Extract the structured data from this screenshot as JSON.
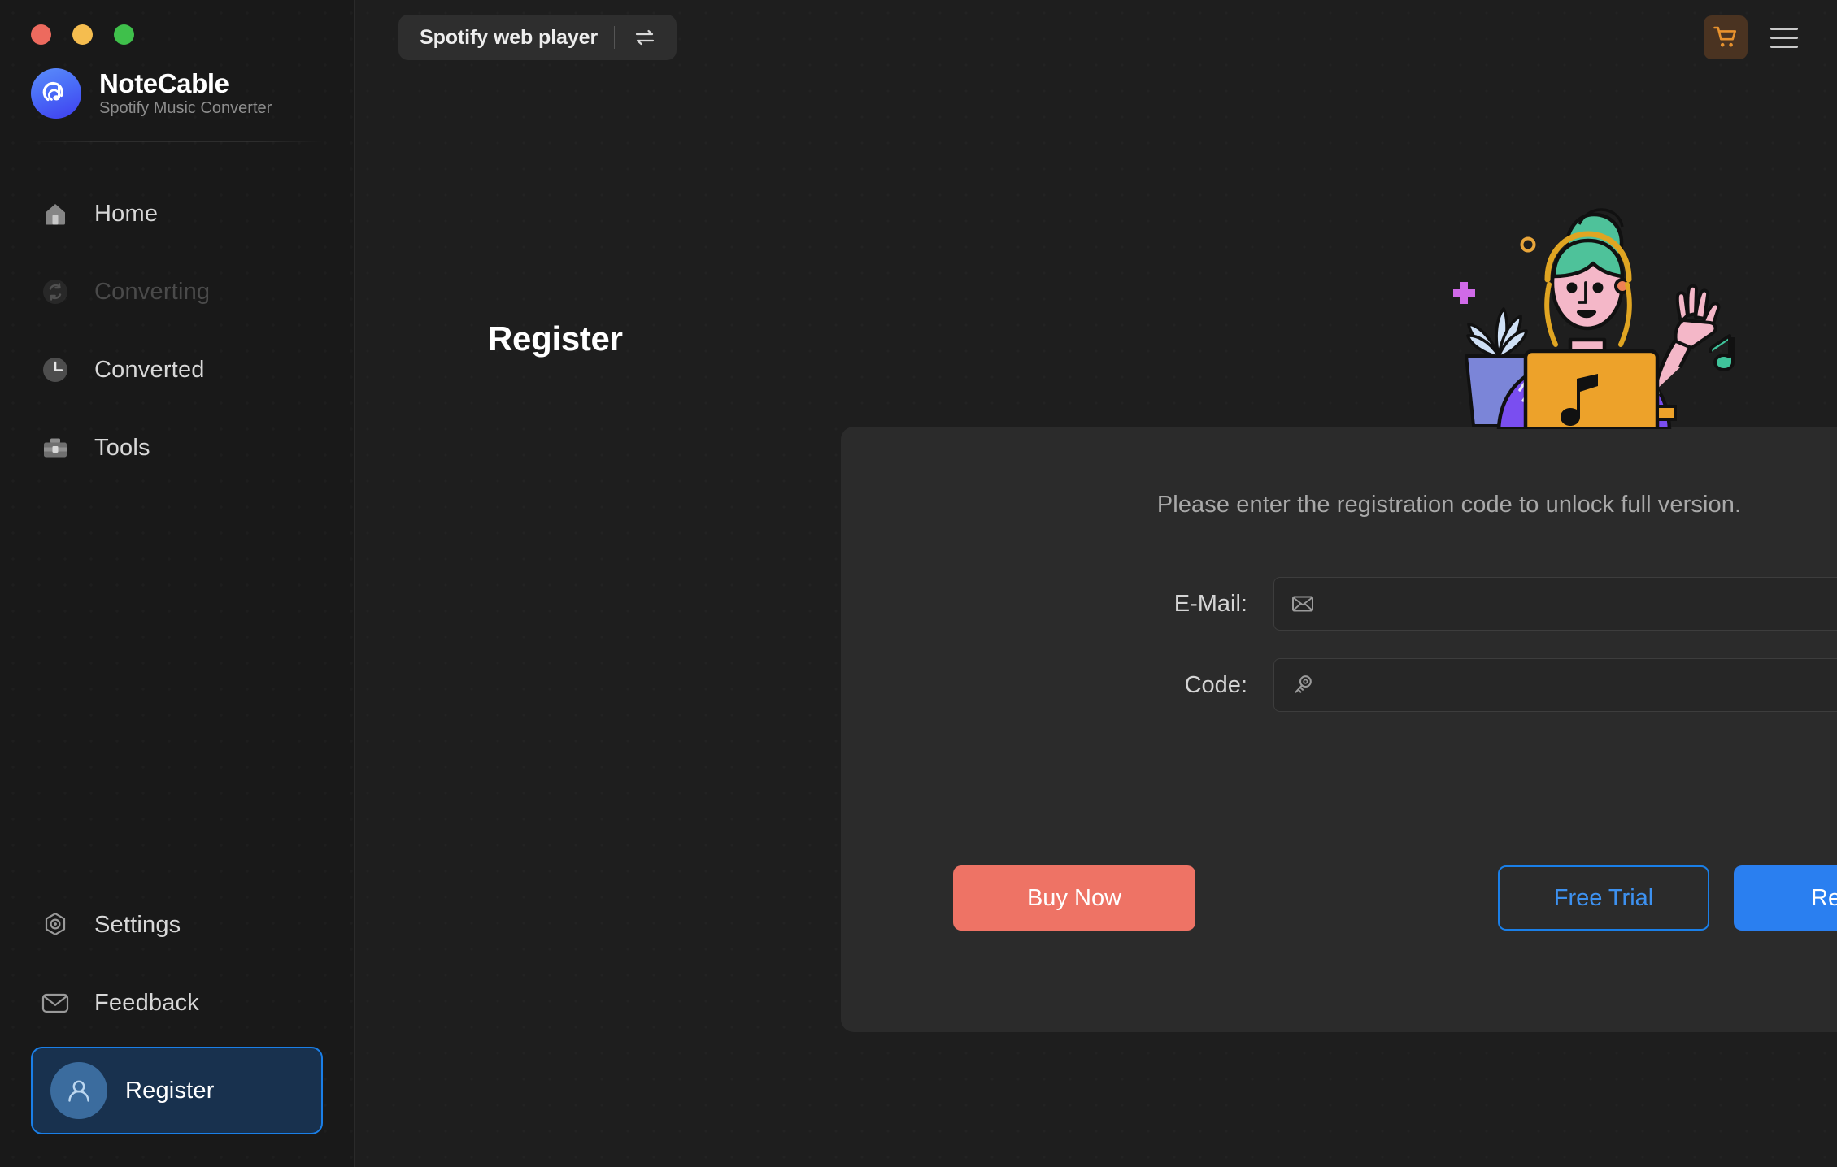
{
  "window": {
    "traffic_lights": [
      {
        "name": "close",
        "color": "#ed6a5e"
      },
      {
        "name": "minimize",
        "color": "#f5bd4f"
      },
      {
        "name": "maximize",
        "color": "#3fc04b"
      }
    ]
  },
  "brand": {
    "name": "NoteCable",
    "subtitle": "Spotify Music Converter",
    "logo_icon": "notecable-logo-icon"
  },
  "sidebar": {
    "items": [
      {
        "label": "Home",
        "icon": "home-icon",
        "state": "normal"
      },
      {
        "label": "Converting",
        "icon": "converting-icon",
        "state": "disabled"
      },
      {
        "label": "Converted",
        "icon": "clock-icon",
        "state": "normal"
      },
      {
        "label": "Tools",
        "icon": "toolbox-icon",
        "state": "normal"
      }
    ],
    "bottom_items": [
      {
        "label": "Settings",
        "icon": "gear-icon",
        "state": "normal"
      },
      {
        "label": "Feedback",
        "icon": "mail-icon",
        "state": "normal"
      }
    ],
    "active_item": {
      "label": "Register",
      "icon": "user-avatar-icon",
      "state": "active"
    }
  },
  "topbar": {
    "source_label": "Spotify web player",
    "swap_icon": "swap-arrows-icon",
    "cart_icon": "shopping-cart-icon",
    "menu_icon": "hamburger-menu-icon",
    "cart_color": "#e8922e"
  },
  "page": {
    "title": "Register",
    "illustration": "waving-person-with-laptop-illustration"
  },
  "card": {
    "subtitle": "Please enter the registration code to unlock full version.",
    "fields": [
      {
        "label": "E-Mail:",
        "icon": "envelope-icon",
        "value": "",
        "placeholder": ""
      },
      {
        "label": "Code:",
        "icon": "key-icon",
        "value": "",
        "placeholder": ""
      }
    ],
    "buttons": {
      "buy": "Buy Now",
      "trial": "Free Trial",
      "register": "Register"
    }
  },
  "colors": {
    "accent_blue": "#2a7ff0",
    "buy_coral": "#ee7365",
    "app_bg": "#1e1e1e",
    "sidebar_bg": "#191919",
    "card_bg": "#2b2b2b"
  }
}
